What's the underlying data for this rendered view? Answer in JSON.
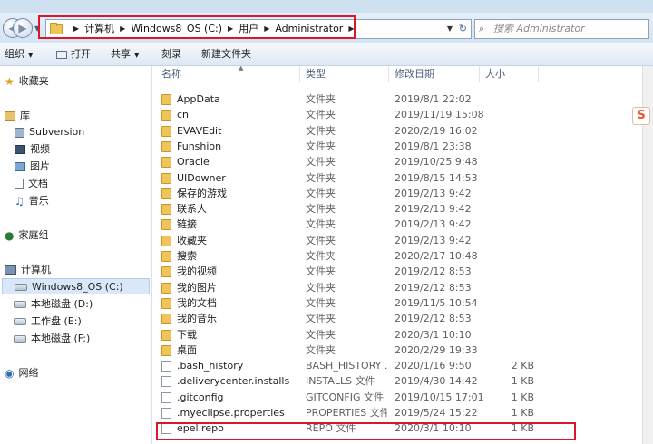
{
  "address_bar": {
    "breadcrumbs": [
      "计算机",
      "Windows8_OS (C:)",
      "用户",
      "Administrator"
    ],
    "search_placeholder": "搜索 Administrator"
  },
  "toolbar": {
    "organize_label": "组织",
    "open_label": "打开",
    "share_label": "共享",
    "burn_label": "刻录",
    "new_folder_label": "新建文件夹"
  },
  "nav": {
    "favorites": "收藏夹",
    "libraries": "库",
    "lib_items": [
      "Subversion",
      "视频",
      "图片",
      "文档",
      "音乐"
    ],
    "homegroup": "家庭组",
    "computer": "计算机",
    "drives": [
      "Windows8_OS (C:)",
      "本地磁盘 (D:)",
      "工作盘 (E:)",
      "本地磁盘 (F:)"
    ],
    "network": "网络"
  },
  "columns": {
    "name": "名称",
    "type": "类型",
    "date": "修改日期",
    "size": "大小"
  },
  "files": [
    {
      "name": "AppData",
      "type": "文件夹",
      "date": "2019/8/1 22:02",
      "size": "",
      "kind": "folder"
    },
    {
      "name": "cn",
      "type": "文件夹",
      "date": "2019/11/19 15:08",
      "size": "",
      "kind": "folder"
    },
    {
      "name": "EVAVEdit",
      "type": "文件夹",
      "date": "2020/2/19 16:02",
      "size": "",
      "kind": "folder"
    },
    {
      "name": "Funshion",
      "type": "文件夹",
      "date": "2019/8/1 23:38",
      "size": "",
      "kind": "folder"
    },
    {
      "name": "Oracle",
      "type": "文件夹",
      "date": "2019/10/25 9:48",
      "size": "",
      "kind": "folder"
    },
    {
      "name": "UIDowner",
      "type": "文件夹",
      "date": "2019/8/15 14:53",
      "size": "",
      "kind": "folder"
    },
    {
      "name": "保存的游戏",
      "type": "文件夹",
      "date": "2019/2/13 9:42",
      "size": "",
      "kind": "folder"
    },
    {
      "name": "联系人",
      "type": "文件夹",
      "date": "2019/2/13 9:42",
      "size": "",
      "kind": "folder"
    },
    {
      "name": "链接",
      "type": "文件夹",
      "date": "2019/2/13 9:42",
      "size": "",
      "kind": "folder"
    },
    {
      "name": "收藏夹",
      "type": "文件夹",
      "date": "2019/2/13 9:42",
      "size": "",
      "kind": "folder"
    },
    {
      "name": "搜索",
      "type": "文件夹",
      "date": "2020/2/17 10:48",
      "size": "",
      "kind": "folder"
    },
    {
      "name": "我的视频",
      "type": "文件夹",
      "date": "2019/2/12 8:53",
      "size": "",
      "kind": "folder"
    },
    {
      "name": "我的图片",
      "type": "文件夹",
      "date": "2019/2/12 8:53",
      "size": "",
      "kind": "folder"
    },
    {
      "name": "我的文档",
      "type": "文件夹",
      "date": "2019/11/5 10:54",
      "size": "",
      "kind": "folder"
    },
    {
      "name": "我的音乐",
      "type": "文件夹",
      "date": "2019/2/12 8:53",
      "size": "",
      "kind": "folder"
    },
    {
      "name": "下载",
      "type": "文件夹",
      "date": "2020/3/1 10:10",
      "size": "",
      "kind": "folder"
    },
    {
      "name": "桌面",
      "type": "文件夹",
      "date": "2020/2/29 19:33",
      "size": "",
      "kind": "folder"
    },
    {
      "name": ".bash_history",
      "type": "BASH_HISTORY ...",
      "date": "2020/1/16 9:50",
      "size": "2 KB",
      "kind": "file"
    },
    {
      "name": ".deliverycenter.installs",
      "type": "INSTALLS 文件",
      "date": "2019/4/30 14:42",
      "size": "1 KB",
      "kind": "file"
    },
    {
      "name": ".gitconfig",
      "type": "GITCONFIG 文件",
      "date": "2019/10/15 17:01",
      "size": "1 KB",
      "kind": "file"
    },
    {
      "name": ".myeclipse.properties",
      "type": "PROPERTIES 文件",
      "date": "2019/5/24 15:22",
      "size": "1 KB",
      "kind": "file"
    },
    {
      "name": "epel.repo",
      "type": "REPO 文件",
      "date": "2020/3/1 10:10",
      "size": "1 KB",
      "kind": "file"
    }
  ],
  "ime_badge": "S"
}
